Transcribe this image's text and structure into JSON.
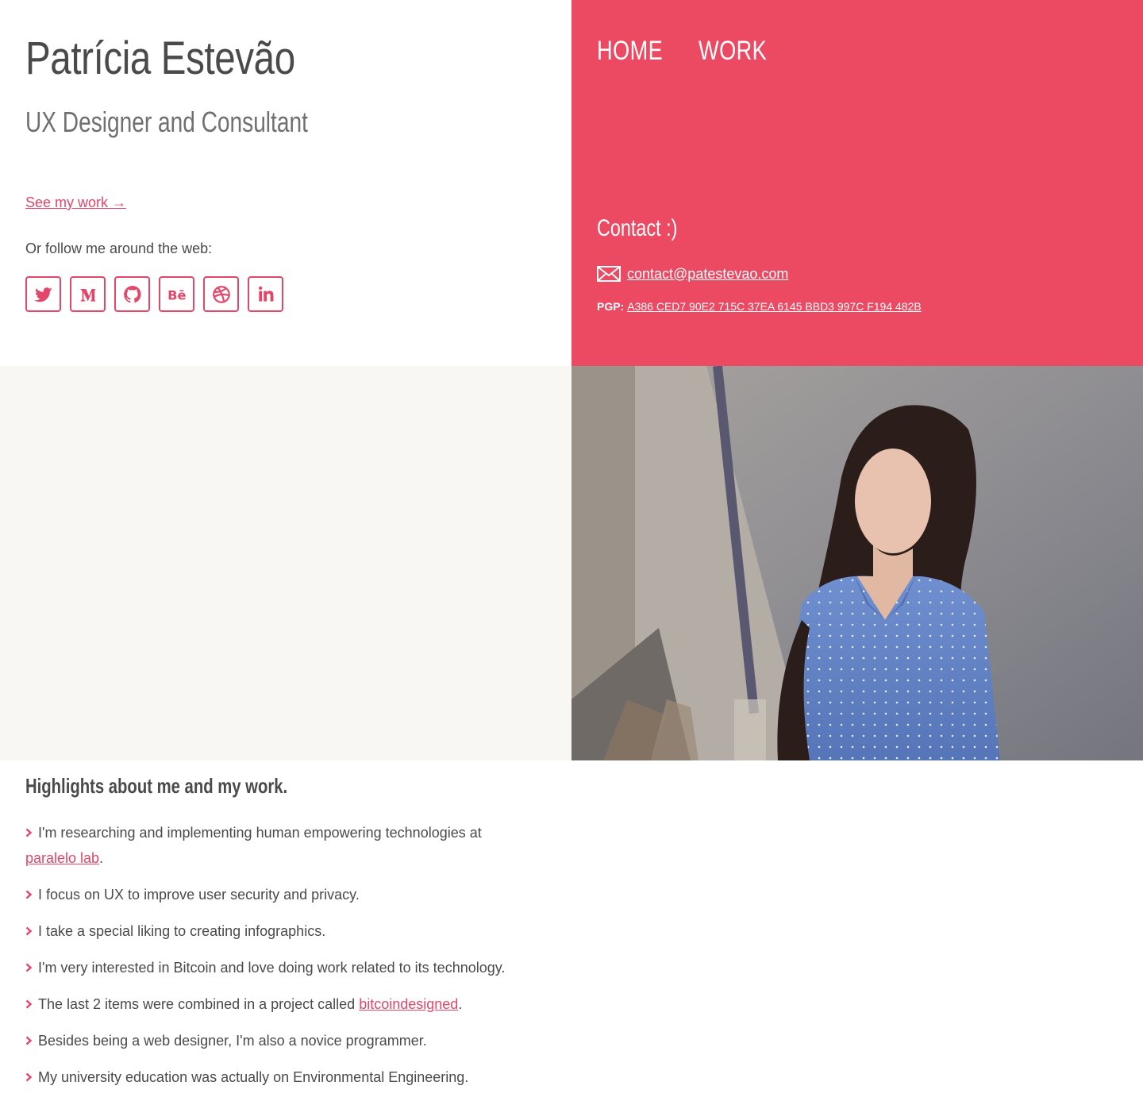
{
  "profile": {
    "name": "Patrícia Estevão",
    "role": "UX Designer and Consultant",
    "see_work": "See my work →",
    "follow": "Or follow me around the web:"
  },
  "socials": [
    {
      "name": "twitter-icon",
      "label": "Twitter"
    },
    {
      "name": "medium-icon",
      "label": "Medium"
    },
    {
      "name": "github-icon",
      "label": "GitHub"
    },
    {
      "name": "behance-icon",
      "label": "Behance"
    },
    {
      "name": "dribbble-icon",
      "label": "Dribbble"
    },
    {
      "name": "linkedin-icon",
      "label": "LinkedIn"
    }
  ],
  "nav": {
    "home": "HOME",
    "work": "WORK"
  },
  "contact": {
    "title": "Contact :)",
    "email": "contact@patestevao.com",
    "pgp_label": "PGP:",
    "pgp_key": "A386 CED7 90E2 715C 37EA 6145 BBD3 997C F194 482B"
  },
  "highlights": {
    "title": "Highlights about me and my work.",
    "item1_text": "I'm researching and implementing human empowering technologies at",
    "item1_link": "paralelo lab",
    "item1_suffix": ".",
    "item2": "I focus on UX to improve user security and privacy.",
    "item3": "I take a special liking to creating infographics.",
    "item4": "I'm very interested in Bitcoin and love doing work related to its technology.",
    "item5_text": "The last 2 items were combined in a project called",
    "item5_link": "bitcoindesigned",
    "item5_suffix": ".",
    "item6": "Besides being a web designer, I'm also a novice programmer.",
    "item7": "My university education was actually on Environmental Engineering."
  },
  "colors": {
    "accent": "#ec4962",
    "link": "#e2476a",
    "text": "#4a4a4a",
    "panel": "#f8f7f4"
  }
}
